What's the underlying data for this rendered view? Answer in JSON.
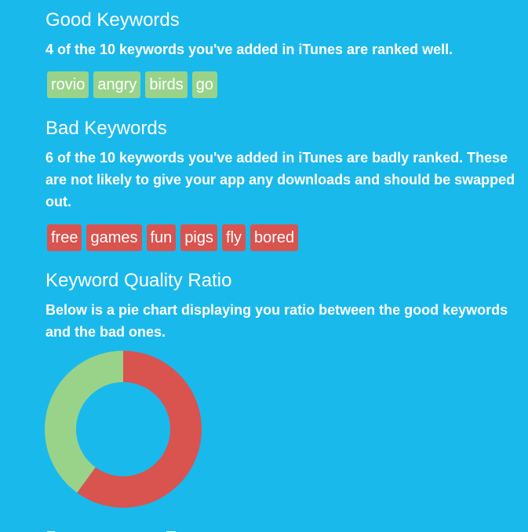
{
  "good": {
    "title": "Good Keywords",
    "description": "4 of the 10 keywords you've added in iTunes are ranked well.",
    "tags": [
      "rovio",
      "angry",
      "birds",
      "go"
    ],
    "color": "#99d38a"
  },
  "bad": {
    "title": "Bad Keywords",
    "description": "6 of the 10 keywords you've added in iTunes are badly ranked. These are not likely to give your app any downloads and should be swapped out.",
    "tags": [
      "free",
      "games",
      "fun",
      "pigs",
      "fly",
      "bored"
    ],
    "color": "#d9534f"
  },
  "ratio": {
    "title": "Keyword Quality Ratio",
    "description": "Below is a pie chart displaying you ratio between the good keywords and the bad ones."
  },
  "colors": {
    "background": "#1ab9ec",
    "text": "#ffffff"
  },
  "chart_data": {
    "type": "pie",
    "donut": true,
    "categories": [
      "Bad",
      "Good"
    ],
    "values": [
      6,
      4
    ],
    "colors": [
      "#d9534f",
      "#99d38a"
    ],
    "start_angle": "top",
    "direction": "clockwise"
  }
}
